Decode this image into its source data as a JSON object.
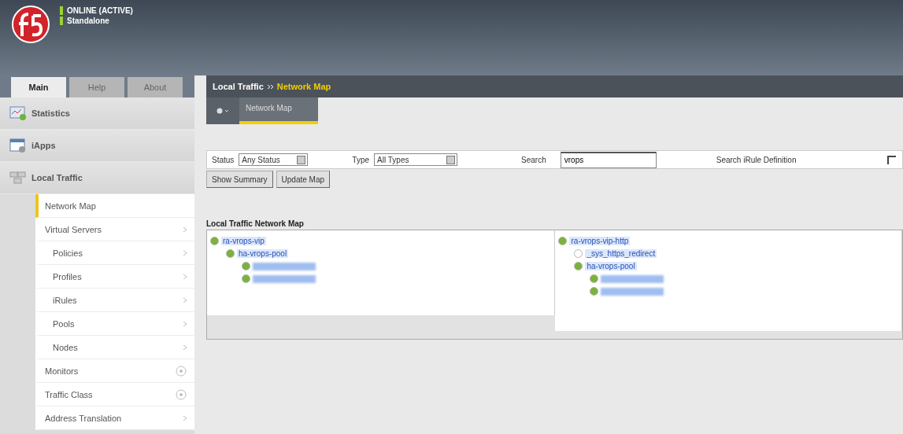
{
  "header": {
    "status_lines": [
      "ONLINE (ACTIVE)",
      "Standalone"
    ]
  },
  "sidebar": {
    "tabs": [
      {
        "label": "Main",
        "selected": true
      },
      {
        "label": "Help",
        "selected": false
      },
      {
        "label": "About",
        "selected": false
      }
    ],
    "sections": [
      {
        "label": "Statistics",
        "kind": "chart"
      },
      {
        "label": "iApps",
        "kind": "window"
      },
      {
        "label": "Local Traffic",
        "kind": "servers"
      }
    ],
    "items": [
      {
        "label": "Network Map",
        "selected": true,
        "kind": "plain"
      },
      {
        "label": "Virtual Servers",
        "selected": false,
        "kind": "arrow",
        "children": [
          {
            "label": "Policies",
            "selected": false,
            "kind": "arrow"
          },
          {
            "label": "Profiles",
            "selected": false,
            "kind": "arrow"
          },
          {
            "label": "iRules",
            "selected": false,
            "kind": "arrow"
          },
          {
            "label": "Pools",
            "selected": false,
            "kind": "arrow"
          },
          {
            "label": "Nodes",
            "selected": false,
            "kind": "arrow"
          }
        ]
      },
      {
        "label": "Monitors",
        "selected": false,
        "kind": "plus"
      },
      {
        "label": "Traffic Class",
        "selected": false,
        "kind": "plus"
      },
      {
        "label": "Address Translation",
        "selected": false,
        "kind": "arrow"
      }
    ]
  },
  "breadcrumb": [
    "Local Traffic",
    "Network Map"
  ],
  "subtabs": [
    {
      "label": "Network Map",
      "selected": true
    }
  ],
  "filters": {
    "status_label": "Status",
    "status_value": "Any Status",
    "type_label": "Type",
    "type_value": "All Types",
    "search_label": "Search",
    "search_value": "vrops",
    "irule_label": "Search iRule Definition",
    "irule_checked": false
  },
  "buttons": [
    "Show Summary",
    "Update Map"
  ],
  "map": {
    "title": "Local Traffic Network Map",
    "panels": [
      {
        "nodes": [
          {
            "label": "ra-vrops-vip",
            "color": "#7ab33a",
            "kind": "link",
            "children": [
              {
                "label": "ha-vrops-pool",
                "color": "#7ab33a",
                "kind": "link",
                "children": [
                  {
                    "color": "#7ab33a",
                    "kind": "redacted"
                  },
                  {
                    "color": "#7ab33a",
                    "kind": "redacted"
                  }
                ]
              }
            ]
          }
        ]
      },
      {
        "nodes": [
          {
            "label": "ra-vrops-vip-http",
            "color": "#7ab33a",
            "kind": "link",
            "children": [
              {
                "label": "_sys_https_redirect",
                "color": "#ffffff",
                "kind": "link"
              },
              {
                "label": "ha-vrops-pool",
                "color": "#7ab33a",
                "kind": "link",
                "children": [
                  {
                    "color": "#7ab33a",
                    "kind": "redacted"
                  },
                  {
                    "color": "#7ab33a",
                    "kind": "redacted"
                  }
                ]
              }
            ]
          }
        ]
      }
    ]
  }
}
